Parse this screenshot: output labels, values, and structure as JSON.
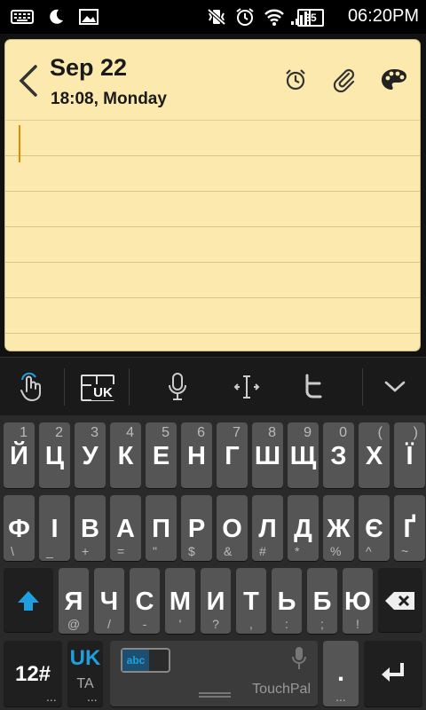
{
  "status_bar": {
    "time": "06:20PM",
    "battery": "35"
  },
  "note": {
    "date": "Sep 22",
    "time_day": "18:08, Monday"
  },
  "keyboard": {
    "row1": [
      {
        "main": "Й",
        "hint": "1"
      },
      {
        "main": "Ц",
        "hint": "2"
      },
      {
        "main": "У",
        "hint": "3"
      },
      {
        "main": "К",
        "hint": "4"
      },
      {
        "main": "Е",
        "hint": "5"
      },
      {
        "main": "Н",
        "hint": "6"
      },
      {
        "main": "Г",
        "hint": "7"
      },
      {
        "main": "Ш",
        "hint": "8"
      },
      {
        "main": "Щ",
        "hint": "9"
      },
      {
        "main": "З",
        "hint": "0"
      },
      {
        "main": "Х",
        "hint": "("
      },
      {
        "main": "Ї",
        "hint": ")"
      }
    ],
    "row2": [
      {
        "main": "Ф",
        "hint": "\\"
      },
      {
        "main": "І",
        "hint": "_"
      },
      {
        "main": "В",
        "hint": "+"
      },
      {
        "main": "А",
        "hint": "="
      },
      {
        "main": "П",
        "hint": "\""
      },
      {
        "main": "Р",
        "hint": "$"
      },
      {
        "main": "О",
        "hint": "&"
      },
      {
        "main": "Л",
        "hint": "#"
      },
      {
        "main": "Д",
        "hint": "*"
      },
      {
        "main": "Ж",
        "hint": "%"
      },
      {
        "main": "Є",
        "hint": "^"
      },
      {
        "main": "Ґ",
        "hint": "~"
      }
    ],
    "row3": [
      {
        "main": "Я",
        "hint": "@"
      },
      {
        "main": "Ч",
        "hint": "/"
      },
      {
        "main": "С",
        "hint": "-"
      },
      {
        "main": "М",
        "hint": "'"
      },
      {
        "main": "И",
        "hint": "?"
      },
      {
        "main": "Т",
        "hint": ","
      },
      {
        "main": "Ь",
        "hint": ":"
      },
      {
        "main": "Б",
        "hint": ";"
      },
      {
        "main": "Ю",
        "hint": "!"
      }
    ],
    "symbol_key": "12#",
    "lang_key_main": "UK",
    "lang_key_sub": "TA",
    "toolbar_lang": "UK",
    "space_brand": "TouchPal",
    "space_mode": "abc",
    "period_key": ".",
    "more_hint": "..."
  },
  "colors": {
    "note_paper": "#fbe9ad",
    "accent_blue": "#1ea0e0",
    "cursor": "#e08a00"
  }
}
